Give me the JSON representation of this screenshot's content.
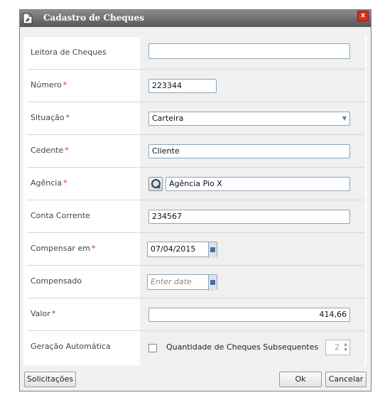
{
  "dialog": {
    "title": "Cadastro de Cheques",
    "close_label": "x"
  },
  "fields": {
    "leitora": {
      "label": "Leitora de Cheques",
      "value": ""
    },
    "numero": {
      "label": "Número",
      "required": "*",
      "value": "223344"
    },
    "situacao": {
      "label": "Situação",
      "required": "*",
      "value": "Carteira"
    },
    "cedente": {
      "label": "Cedente",
      "required": "*",
      "value": "Cliente"
    },
    "agencia": {
      "label": "Agência",
      "required": "*",
      "value": "Agência Pio X"
    },
    "conta": {
      "label": "Conta Corrente",
      "value": "234567"
    },
    "compensar": {
      "label": "Compensar em",
      "required": "*",
      "value": "07/04/2015"
    },
    "compensado": {
      "label": "Compensado",
      "placeholder": "Enter date"
    },
    "valor": {
      "label": "Valor",
      "required": "*",
      "value": "414,66"
    },
    "geracao": {
      "label": "Geração Automática",
      "checkbox_label": "Quantidade de Cheques Subsequentes",
      "quantity": "2"
    }
  },
  "footer": {
    "solicitacoes": "Solicitações",
    "ok": "Ok",
    "cancelar": "Cancelar"
  },
  "icons": {
    "title": "cheque-form-icon",
    "select": "chevron-down-icon",
    "calendar": "calendar-icon",
    "search": "search-icon"
  },
  "colors": {
    "title_bar": "#6e6e6e",
    "required_marker": "#e0271c",
    "input_border": "#8da6b9",
    "close_button": "#d7311a"
  }
}
